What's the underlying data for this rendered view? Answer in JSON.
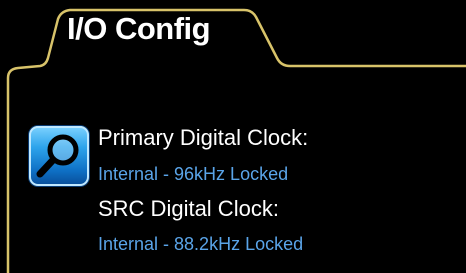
{
  "tab": {
    "title": "I/O Config"
  },
  "icons": {
    "search": "magnifier-icon"
  },
  "clocks": {
    "primary": {
      "label": "Primary Digital Clock:",
      "value": "Internal - 96kHz Locked"
    },
    "src": {
      "label": "SRC Digital Clock:",
      "value": "Internal - 88.2kHz Locked"
    }
  },
  "colors": {
    "background": "#000000",
    "border": "#d8c36a",
    "value_text": "#5aa4e8",
    "label_text": "#ffffff"
  }
}
